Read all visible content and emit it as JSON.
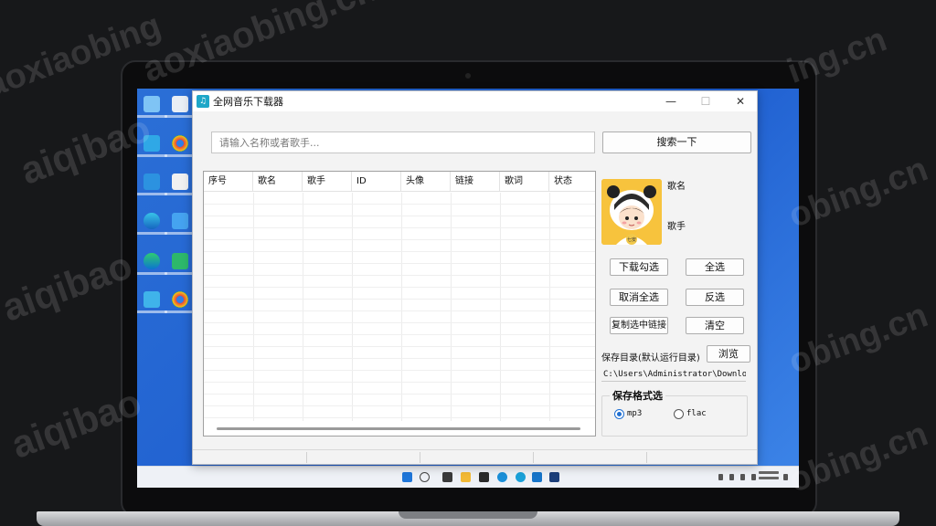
{
  "watermark": {
    "text_1": "aoxiaobing",
    "text_2": "aiqibao",
    "text_3": "ing.cn",
    "text_4": "obing.cn",
    "text_5": "aoxiaobing.cn"
  },
  "window": {
    "title": "全网音乐下载器",
    "minimize": "—",
    "maximize": "☐",
    "close": "✕"
  },
  "search": {
    "placeholder": "请输入名称或者歌手...",
    "button": "搜索一下"
  },
  "table": {
    "columns": [
      "序号",
      "歌名",
      "歌手",
      "ID",
      "头像",
      "链接",
      "歌词",
      "状态"
    ],
    "rows": []
  },
  "song_info": {
    "avatar_caption": "七安",
    "name_label": "歌名",
    "singer_label": "歌手"
  },
  "actions": {
    "download_selected": "下载勾选",
    "select_all": "全选",
    "deselect_all": "取消全选",
    "invert": "反选",
    "copy_links": "复制选中链接",
    "clear": "清空"
  },
  "save": {
    "label": "保存目录(默认运行目录)",
    "browse": "浏览",
    "path": "C:\\Users\\Administrator\\Downloads"
  },
  "format": {
    "title": "保存格式选",
    "selected": "mp3",
    "options": [
      "mp3",
      "flac"
    ]
  },
  "colors": {
    "desktop": "#1f5fd0",
    "radio_accent": "#1f6fd2",
    "avatar_bg": "#f7c33d"
  }
}
